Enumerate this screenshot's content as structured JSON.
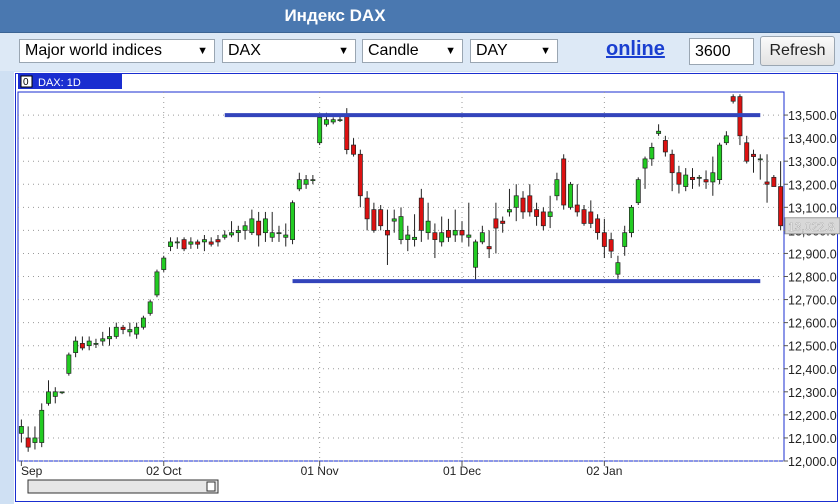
{
  "window": {
    "title": "Индекс DAX"
  },
  "toolbar": {
    "group_value": "Major world indices",
    "index_value": "DAX",
    "chart_type_value": "Candle",
    "period_value": "DAY",
    "online_link": "online",
    "count_value": "3600",
    "refresh_label": "Refresh"
  },
  "colors": {
    "up": "#22cc22",
    "down": "#dd1111",
    "line": "#3344bb",
    "frame": "#1a2ed0"
  },
  "icons": {
    "dropdown": "chevron-down-icon"
  },
  "chart_data": {
    "type": "candlestick",
    "title": "",
    "legend_box": "0",
    "legend_label": "DAX: 1D",
    "last_price_label": "13,022.8",
    "ylim": [
      12000,
      13600
    ],
    "y_ticks": [
      12000,
      12100,
      12200,
      12300,
      12400,
      12500,
      12600,
      12700,
      12800,
      12900,
      13000,
      13100,
      13200,
      13300,
      13400,
      13500
    ],
    "y_tick_labels": [
      "12,000.0",
      "12,100.0",
      "12,200.0",
      "12,300.0",
      "12,400.0",
      "12,500.0",
      "12,600.0",
      "12,700.0",
      "12,800.0",
      "12,900.0",
      "13,000.0",
      "13,100.0",
      "13,200.0",
      "13,300.0",
      "13,400.0",
      "13,500.0"
    ],
    "x_labels": [
      "Sep",
      "02 Oct",
      "01 Nov",
      "01 Dec",
      "02 Jan"
    ],
    "x_label_index": [
      0,
      21,
      44,
      65,
      86
    ],
    "grid": true,
    "horizontal_lines": [
      {
        "value": 13500,
        "from_index": 30,
        "to_index": 109
      },
      {
        "value": 12780,
        "from_index": 40,
        "to_index": 109
      }
    ],
    "candles": [
      [
        12120,
        12180,
        12080,
        12150
      ],
      [
        12100,
        12150,
        12040,
        12060
      ],
      [
        12080,
        12150,
        12050,
        12100
      ],
      [
        12080,
        12250,
        12060,
        12220
      ],
      [
        12250,
        12350,
        12240,
        12300
      ],
      [
        12280,
        12320,
        12250,
        12300
      ],
      [
        12300,
        12300,
        12290,
        12300
      ],
      [
        12380,
        12470,
        12370,
        12460
      ],
      [
        12470,
        12540,
        12450,
        12520
      ],
      [
        12510,
        12540,
        12480,
        12490
      ],
      [
        12500,
        12540,
        12480,
        12520
      ],
      [
        12510,
        12530,
        12490,
        12510
      ],
      [
        12520,
        12560,
        12500,
        12530
      ],
      [
        12530,
        12580,
        12500,
        12540
      ],
      [
        12540,
        12600,
        12530,
        12580
      ],
      [
        12580,
        12590,
        12550,
        12570
      ],
      [
        12560,
        12600,
        12540,
        12570
      ],
      [
        12550,
        12600,
        12530,
        12580
      ],
      [
        12580,
        12630,
        12570,
        12620
      ],
      [
        12640,
        12700,
        12630,
        12690
      ],
      [
        12720,
        12830,
        12710,
        12820
      ],
      [
        12830,
        12890,
        12820,
        12880
      ],
      [
        12930,
        12970,
        12910,
        12950
      ],
      [
        12950,
        12970,
        12920,
        12950
      ],
      [
        12960,
        12970,
        12910,
        12920
      ],
      [
        12940,
        12970,
        12920,
        12950
      ],
      [
        12950,
        12960,
        12920,
        12940
      ],
      [
        12950,
        12980,
        12910,
        12960
      ],
      [
        12950,
        12970,
        12930,
        12940
      ],
      [
        12960,
        12980,
        12930,
        12950
      ],
      [
        12970,
        13000,
        12960,
        12980
      ],
      [
        12980,
        13040,
        12970,
        12990
      ],
      [
        12990,
        13020,
        12950,
        13000
      ],
      [
        13000,
        13040,
        12960,
        13020
      ],
      [
        12990,
        13090,
        12980,
        13050
      ],
      [
        13040,
        13080,
        12930,
        12980
      ],
      [
        12990,
        13080,
        12950,
        13050
      ],
      [
        12970,
        13080,
        12950,
        12990
      ],
      [
        12990,
        13020,
        12950,
        12990
      ],
      [
        12970,
        13030,
        12930,
        12980
      ],
      [
        12960,
        13130,
        12940,
        13120
      ],
      [
        13180,
        13250,
        13170,
        13220
      ],
      [
        13200,
        13240,
        13180,
        13220
      ],
      [
        13220,
        13240,
        13200,
        13220
      ],
      [
        13380,
        13500,
        13370,
        13490
      ],
      [
        13460,
        13510,
        13450,
        13480
      ],
      [
        13470,
        13490,
        13460,
        13480
      ],
      [
        13480,
        13500,
        13470,
        13480
      ],
      [
        13500,
        13530,
        13330,
        13350
      ],
      [
        13370,
        13400,
        13320,
        13330
      ],
      [
        13330,
        13350,
        13100,
        13150
      ],
      [
        13140,
        13170,
        13000,
        13050
      ],
      [
        13090,
        13120,
        12990,
        13000
      ],
      [
        13090,
        13110,
        13000,
        13020
      ],
      [
        13000,
        13090,
        12850,
        12980
      ],
      [
        13040,
        13090,
        12990,
        13050
      ],
      [
        12960,
        13100,
        12940,
        13060
      ],
      [
        12960,
        13020,
        12910,
        12980
      ],
      [
        12960,
        13070,
        12930,
        12970
      ],
      [
        13140,
        13180,
        12950,
        13000
      ],
      [
        12990,
        13120,
        12960,
        13040
      ],
      [
        12990,
        13030,
        12880,
        12960
      ],
      [
        12950,
        13060,
        12930,
        12990
      ],
      [
        13000,
        13050,
        12950,
        12970
      ],
      [
        12980,
        13090,
        12950,
        13000
      ],
      [
        13000,
        13040,
        12950,
        12980
      ],
      [
        12970,
        13120,
        12930,
        12980
      ],
      [
        12840,
        12960,
        12780,
        12950
      ],
      [
        12950,
        13020,
        12940,
        12990
      ],
      [
        12930,
        13000,
        12880,
        12920
      ],
      [
        13050,
        13120,
        12900,
        13010
      ],
      [
        13040,
        13060,
        12990,
        13030
      ],
      [
        13080,
        13180,
        13060,
        13090
      ],
      [
        13100,
        13200,
        13040,
        13150
      ],
      [
        13140,
        13170,
        13050,
        13080
      ],
      [
        13150,
        13200,
        13060,
        13080
      ],
      [
        13090,
        13120,
        13020,
        13060
      ],
      [
        13080,
        13100,
        13000,
        13020
      ],
      [
        13060,
        13150,
        13010,
        13080
      ],
      [
        13150,
        13250,
        13130,
        13220
      ],
      [
        13310,
        13330,
        13090,
        13110
      ],
      [
        13100,
        13210,
        13090,
        13200
      ],
      [
        13110,
        13200,
        13060,
        13080
      ],
      [
        13090,
        13110,
        13020,
        13030
      ],
      [
        13080,
        13130,
        13010,
        13030
      ],
      [
        13050,
        13070,
        12960,
        12990
      ],
      [
        12990,
        13050,
        12880,
        12930
      ],
      [
        12960,
        12990,
        12880,
        12910
      ],
      [
        12810,
        12890,
        12790,
        12860
      ],
      [
        12930,
        13020,
        12890,
        12990
      ],
      [
        12990,
        13110,
        12970,
        13100
      ],
      [
        13120,
        13230,
        13110,
        13220
      ],
      [
        13270,
        13320,
        13180,
        13310
      ],
      [
        13310,
        13380,
        13280,
        13360
      ],
      [
        13420,
        13460,
        13410,
        13430
      ],
      [
        13390,
        13410,
        13320,
        13340
      ],
      [
        13330,
        13350,
        13170,
        13250
      ],
      [
        13250,
        13280,
        13160,
        13200
      ],
      [
        13190,
        13270,
        13170,
        13240
      ],
      [
        13230,
        13270,
        13180,
        13220
      ],
      [
        13230,
        13240,
        13190,
        13230
      ],
      [
        13220,
        13260,
        13180,
        13210
      ],
      [
        13210,
        13320,
        13150,
        13250
      ],
      [
        13220,
        13380,
        13200,
        13370
      ],
      [
        13380,
        13430,
        13370,
        13410
      ],
      [
        13580,
        13590,
        13550,
        13560
      ],
      [
        13580,
        13590,
        13370,
        13410
      ],
      [
        13380,
        13410,
        13290,
        13300
      ],
      [
        13330,
        13350,
        13250,
        13320
      ],
      [
        13310,
        13330,
        13220,
        13310
      ],
      [
        13210,
        13330,
        13120,
        13200
      ],
      [
        13230,
        13240,
        13190,
        13190
      ],
      [
        13190,
        13300,
        13000,
        13020
      ]
    ]
  }
}
